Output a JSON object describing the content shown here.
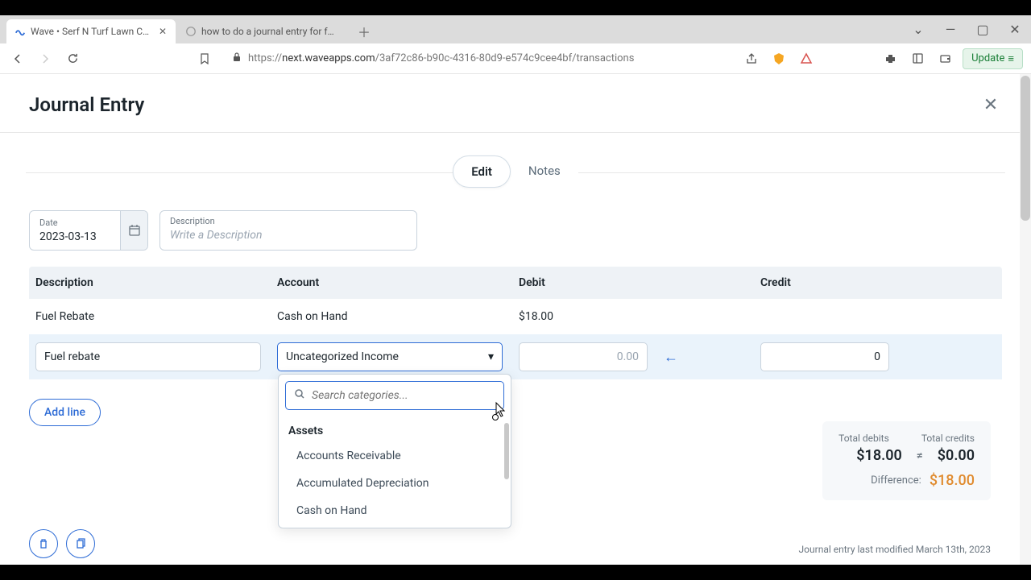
{
  "browser": {
    "tabs": [
      {
        "title": "Wave • Serf N Turf Lawn Care • T"
      },
      {
        "title": "how to do a journal entry for fuel reb"
      }
    ],
    "url_prefix": "https://",
    "url_domain": "next.waveapps.com",
    "url_path": "/3af72c86-b90c-4316-80d9-e574c9cee4bf/transactions",
    "update_label": "Update"
  },
  "page": {
    "title": "Journal Entry",
    "tabs": {
      "edit": "Edit",
      "notes": "Notes"
    },
    "date": {
      "label": "Date",
      "value": "2023-03-13"
    },
    "description": {
      "label": "Description",
      "placeholder": "Write a Description"
    },
    "columns": {
      "description": "Description",
      "account": "Account",
      "debit": "Debit",
      "credit": "Credit"
    },
    "rows": [
      {
        "description": "Fuel Rebate",
        "account": "Cash on Hand",
        "debit": "$18.00",
        "credit": ""
      }
    ],
    "active_row": {
      "description": "Fuel rebate",
      "account": "Uncategorized Income",
      "debit_placeholder": "0.00",
      "credit": "0"
    },
    "dropdown": {
      "search_placeholder": "Search categories...",
      "group": "Assets",
      "items": [
        "Accounts Receivable",
        "Accumulated Depreciation",
        "Cash on Hand"
      ]
    },
    "add_line": "Add line",
    "totals": {
      "debits_label": "Total debits",
      "credits_label": "Total credits",
      "debits": "$18.00",
      "credits": "$0.00",
      "neq": "≠",
      "diff_label": "Difference:",
      "diff": "$18.00"
    },
    "last_modified": "Journal entry last modified March 13th, 2023"
  }
}
